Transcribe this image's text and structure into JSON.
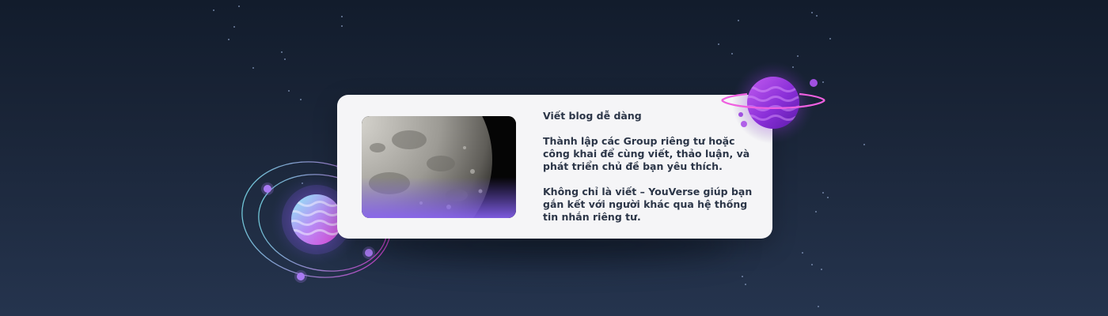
{
  "card": {
    "title": "Viết blog dễ dàng",
    "paragraph_1": "Thành lập các Group riêng tư hoặc công khai để cùng viết, thảo luận, và phát triển chủ đề bạn yêu thích.",
    "paragraph_2": "Không chỉ là viết – YouVerse giúp bạn gắn kết với người khác qua hệ thống tin nhắn riêng tư."
  },
  "illustration": {
    "image": "moon-photo",
    "left_decoration": "orbit-planet-icon",
    "right_decoration": "ringed-planet-icon"
  },
  "colors": {
    "background_top": "#121c2c",
    "background_bottom": "#25344e",
    "card_background": "#f5f5f7",
    "text": "#2c3648",
    "accent_purple": "#a855f7",
    "accent_magenta": "#e040d0",
    "accent_cyan": "#7ee0f0"
  }
}
